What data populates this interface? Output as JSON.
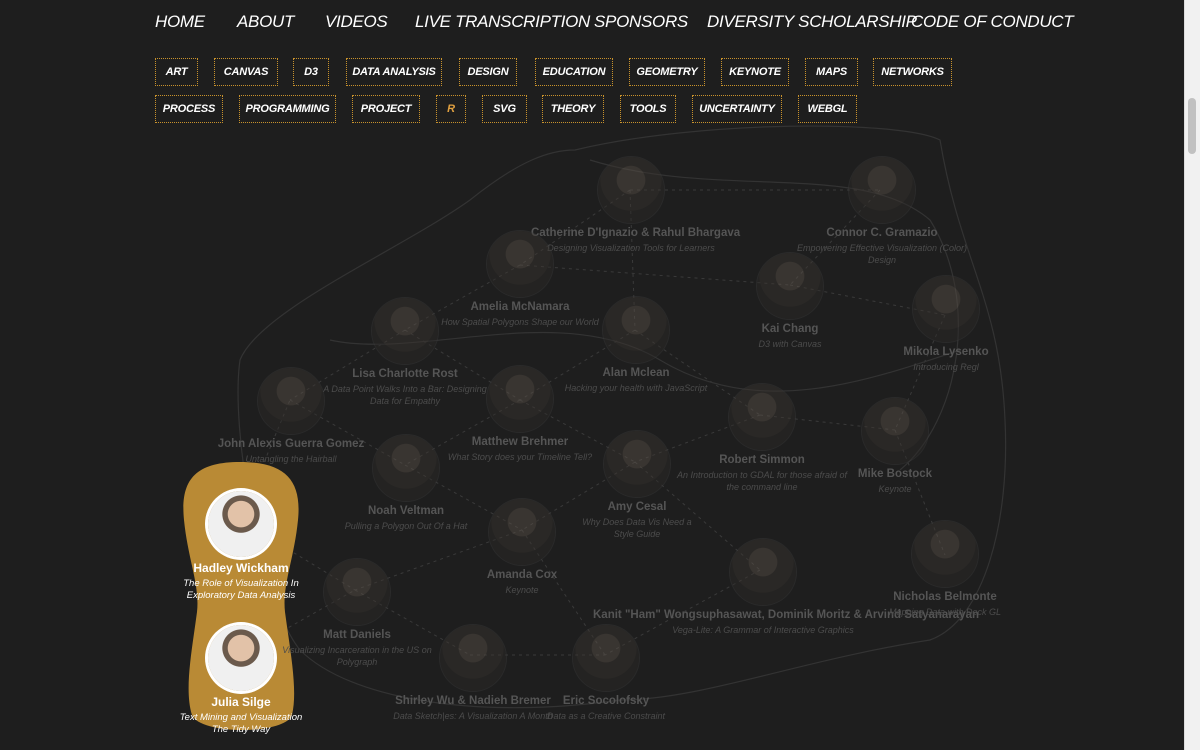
{
  "nav": [
    "HOME",
    "ABOUT",
    "VIDEOS",
    "LIVE TRANSCRIPTION",
    "SPONSORS",
    "DIVERSITY SCHOLARSHIP",
    "CODE OF CONDUCT"
  ],
  "tags_row1": [
    "ART",
    "CANVAS",
    "D3",
    "DATA ANALYSIS",
    "DESIGN",
    "EDUCATION",
    "GEOMETRY",
    "KEYNOTE",
    "MAPS",
    "NETWORKS"
  ],
  "tags_row2": [
    "PROCESS",
    "PROGRAMMING",
    "PROJECT",
    "R",
    "SVG",
    "THEORY",
    "TOOLS",
    "UNCERTAINTY",
    "WEBGL"
  ],
  "active_tag": "R",
  "colors": {
    "accent": "#c8922c",
    "highlight_blob": "#b98a35",
    "background": "#1e1e1e"
  },
  "speakers": [
    {
      "name": "Catherine D'Ignazio & Rahul Bhargava",
      "talk": "Designing Visualization Tools for Learners"
    },
    {
      "name": "Connor C. Gramazio",
      "talk": "Empowering Effective Visualization (Color) Design"
    },
    {
      "name": "Amelia McNamara",
      "talk": "How Spatial Polygons Shape our World"
    },
    {
      "name": "Kai Chang",
      "talk": "D3 with Canvas"
    },
    {
      "name": "Mikola Lysenko",
      "talk": "Introducing Regl"
    },
    {
      "name": "Lisa Charlotte Rost",
      "talk": "A Data Point Walks Into a Bar: Designing Data for Empathy"
    },
    {
      "name": "Alan Mclean",
      "talk": "Hacking your health with JavaScript"
    },
    {
      "name": "John Alexis Guerra Gomez",
      "talk": "Untangling the Hairball"
    },
    {
      "name": "Matthew Brehmer",
      "talk": "What Story does your Timeline Tell?"
    },
    {
      "name": "Robert Simmon",
      "talk": "An Introduction to GDAL for those afraid of the command line"
    },
    {
      "name": "Mike Bostock",
      "talk": "Keynote"
    },
    {
      "name": "Noah Veltman",
      "talk": "Pulling a Polygon Out Of a Hat"
    },
    {
      "name": "Amy Cesal",
      "talk": "Why Does Data Vis Need a Style Guide"
    },
    {
      "name": "Amanda Cox",
      "talk": "Keynote"
    },
    {
      "name": "Kanit \"Ham\" Wongsuphasawat, Dominik Moritz & Arvind Satyanarayan",
      "talk": "Vega-Lite: A Grammar of Interactive Graphics"
    },
    {
      "name": "Nicholas Belmonte",
      "talk": "Mapping Data with Deck GL"
    },
    {
      "name": "Matt Daniels",
      "talk": "Visualizing Incarceration in the US on Polygraph"
    },
    {
      "name": "Shirley Wu & Nadieh Bremer",
      "talk": "Data Sketch|es: A Visualization A Month"
    },
    {
      "name": "Eric Socolofsky",
      "talk": "Data as a Creative Constraint"
    }
  ],
  "highlighted": [
    {
      "name": "Hadley Wickham",
      "talk": "The Role of Visualization In Exploratory Data Analysis"
    },
    {
      "name": "Julia Silge",
      "talk": "Text Mining and Visualization The Tidy Way"
    }
  ]
}
